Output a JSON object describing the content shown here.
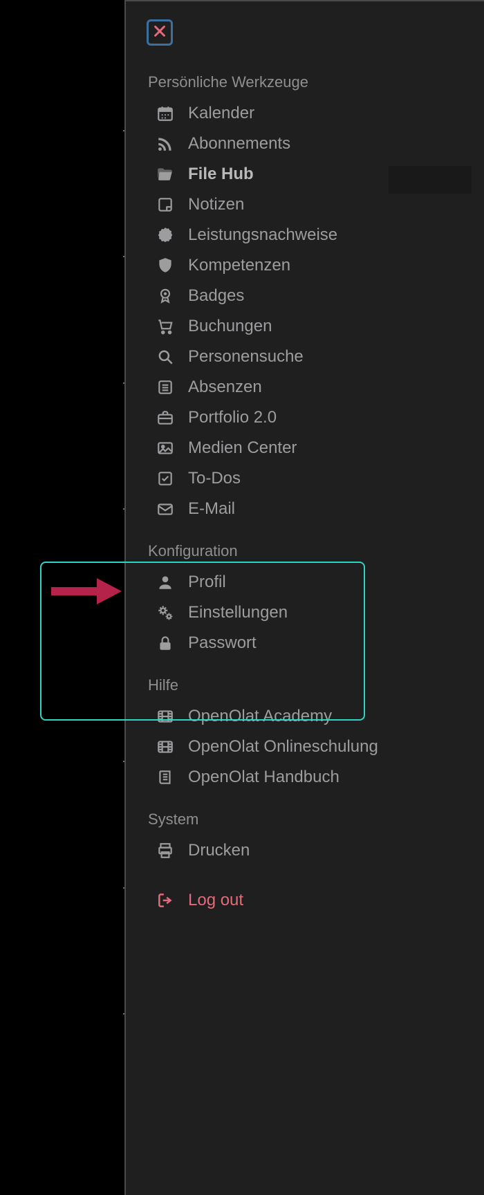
{
  "close_label": "Close",
  "sections": {
    "tools": {
      "title": "Persönliche Werkzeuge",
      "items": [
        {
          "label": "Kalender"
        },
        {
          "label": "Abonnements"
        },
        {
          "label": "File Hub"
        },
        {
          "label": "Notizen"
        },
        {
          "label": "Leistungsnachweise"
        },
        {
          "label": "Kompetenzen"
        },
        {
          "label": "Badges"
        },
        {
          "label": "Buchungen"
        },
        {
          "label": "Personensuche"
        },
        {
          "label": "Absenzen"
        },
        {
          "label": "Portfolio 2.0"
        },
        {
          "label": "Medien Center"
        },
        {
          "label": "To-Dos"
        },
        {
          "label": "E-Mail"
        }
      ]
    },
    "config": {
      "title": "Konfiguration",
      "items": [
        {
          "label": "Profil"
        },
        {
          "label": "Einstellungen"
        },
        {
          "label": "Passwort"
        }
      ]
    },
    "help": {
      "title": "Hilfe",
      "items": [
        {
          "label": "OpenOlat Academy"
        },
        {
          "label": "OpenOlat Onlineschulung"
        },
        {
          "label": "OpenOlat Handbuch"
        }
      ]
    },
    "system": {
      "title": "System",
      "items": [
        {
          "label": "Drucken"
        }
      ]
    },
    "logout": {
      "label": "Log out"
    }
  }
}
